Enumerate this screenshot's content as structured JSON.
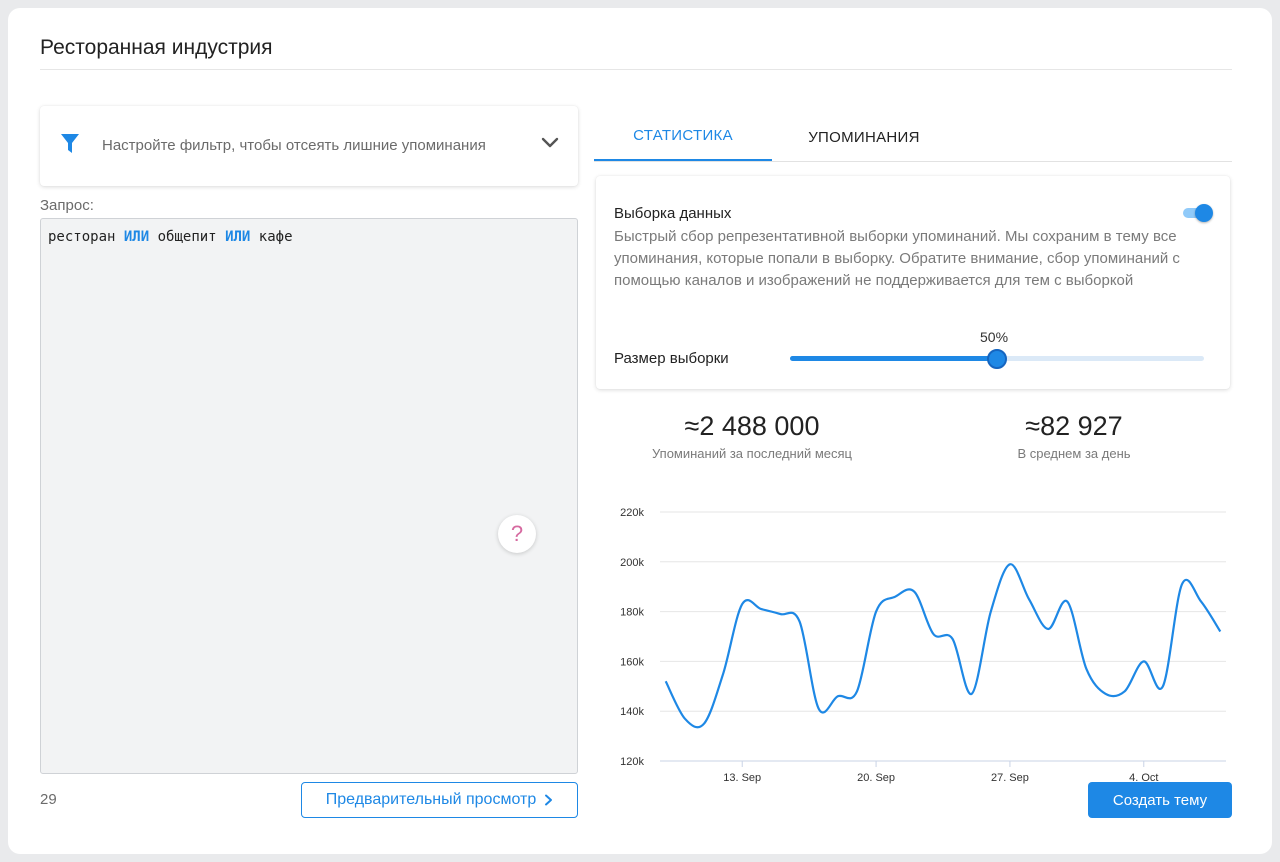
{
  "page": {
    "title": "Ресторанная индустрия"
  },
  "filter": {
    "placeholder_text": "Настройте фильтр, чтобы отсеять лишние упоминания",
    "icon": "filter-icon"
  },
  "query": {
    "label": "Запрос:",
    "tokens": [
      {
        "text": "ресторан",
        "operator": false
      },
      {
        "text": "ИЛИ",
        "operator": true
      },
      {
        "text": "общепит",
        "operator": false
      },
      {
        "text": "ИЛИ",
        "operator": true
      },
      {
        "text": "кафе",
        "operator": false
      }
    ],
    "help_symbol": "?",
    "char_count": "29",
    "preview_button": "Предварительный просмотр"
  },
  "tabs": [
    {
      "label": "СТАТИСТИКА",
      "active": true
    },
    {
      "label": "УПОМИНАНИЯ",
      "active": false
    }
  ],
  "sampling": {
    "title": "Выборка данных",
    "enabled": true,
    "description": "Быстрый сбор репрезентативной выборки упоминаний. Мы сохраним в тему все упоминания, которые попали в выборку. Обратите внимание, сбор упоминаний с помощью каналов и изображений не поддерживается для тем с выборкой",
    "size_label": "Размер выборки",
    "size_value_text": "50%",
    "size_fraction": 0.5
  },
  "stats": {
    "monthly_value": "≈2 488 000",
    "monthly_caption": "Упоминаний за последний месяц",
    "daily_value": "≈82 927",
    "daily_caption": "В среднем за день"
  },
  "chart_data": {
    "type": "line",
    "title": "",
    "xlabel": "",
    "ylabel": "",
    "ylim": [
      120000,
      220000
    ],
    "y_ticks": [
      "120k",
      "140k",
      "160k",
      "180k",
      "200k",
      "220k"
    ],
    "x_tick_labels": [
      "13. Sep",
      "20. Sep",
      "27. Sep",
      "4. Oct"
    ],
    "x_tick_days": [
      13,
      20,
      27,
      34
    ],
    "grid": true,
    "color": "#1e88e5",
    "x_days": [
      9,
      10,
      11,
      12,
      13,
      14,
      15,
      16,
      17,
      18,
      19,
      20,
      21,
      22,
      23,
      24,
      25,
      26,
      27,
      28,
      29,
      30,
      31,
      32,
      33,
      34,
      35,
      36,
      37,
      38
    ],
    "values": [
      152000,
      137000,
      135000,
      155000,
      183000,
      181000,
      179000,
      176000,
      141000,
      146000,
      148000,
      180000,
      186000,
      188000,
      171000,
      169000,
      147000,
      180000,
      199000,
      185000,
      173000,
      184000,
      157000,
      147000,
      148000,
      160000,
      150000,
      191000,
      184000,
      172000
    ]
  },
  "create_button": "Создать тему",
  "colors": {
    "accent": "#1e88e5",
    "help": "#d66aa0"
  }
}
